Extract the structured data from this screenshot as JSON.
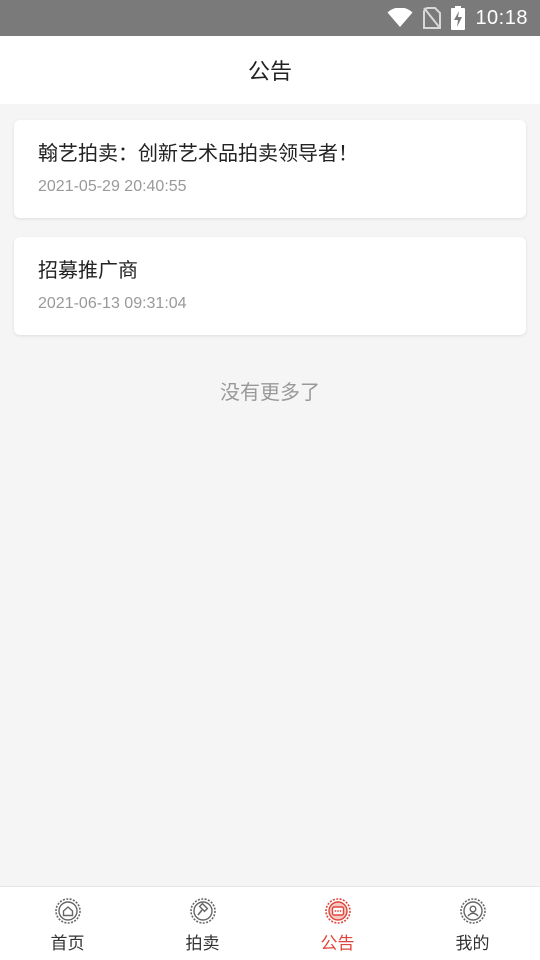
{
  "status_bar": {
    "time": "10:18"
  },
  "header": {
    "title": "公告"
  },
  "announcements": [
    {
      "title": "翰艺拍卖：创新艺术品拍卖领导者！",
      "date": "2021-05-29 20:40:55"
    },
    {
      "title": "招募推广商",
      "date": "2021-06-13 09:31:04"
    }
  ],
  "no_more_text": "没有更多了",
  "tabbar": {
    "items": [
      {
        "label": "首页",
        "icon": "home-icon"
      },
      {
        "label": "拍卖",
        "icon": "auction-hammer-icon"
      },
      {
        "label": "公告",
        "icon": "message-icon",
        "active": true
      },
      {
        "label": "我的",
        "icon": "user-icon"
      }
    ],
    "active_color": "#e0453b",
    "inactive_color": "#333333"
  }
}
